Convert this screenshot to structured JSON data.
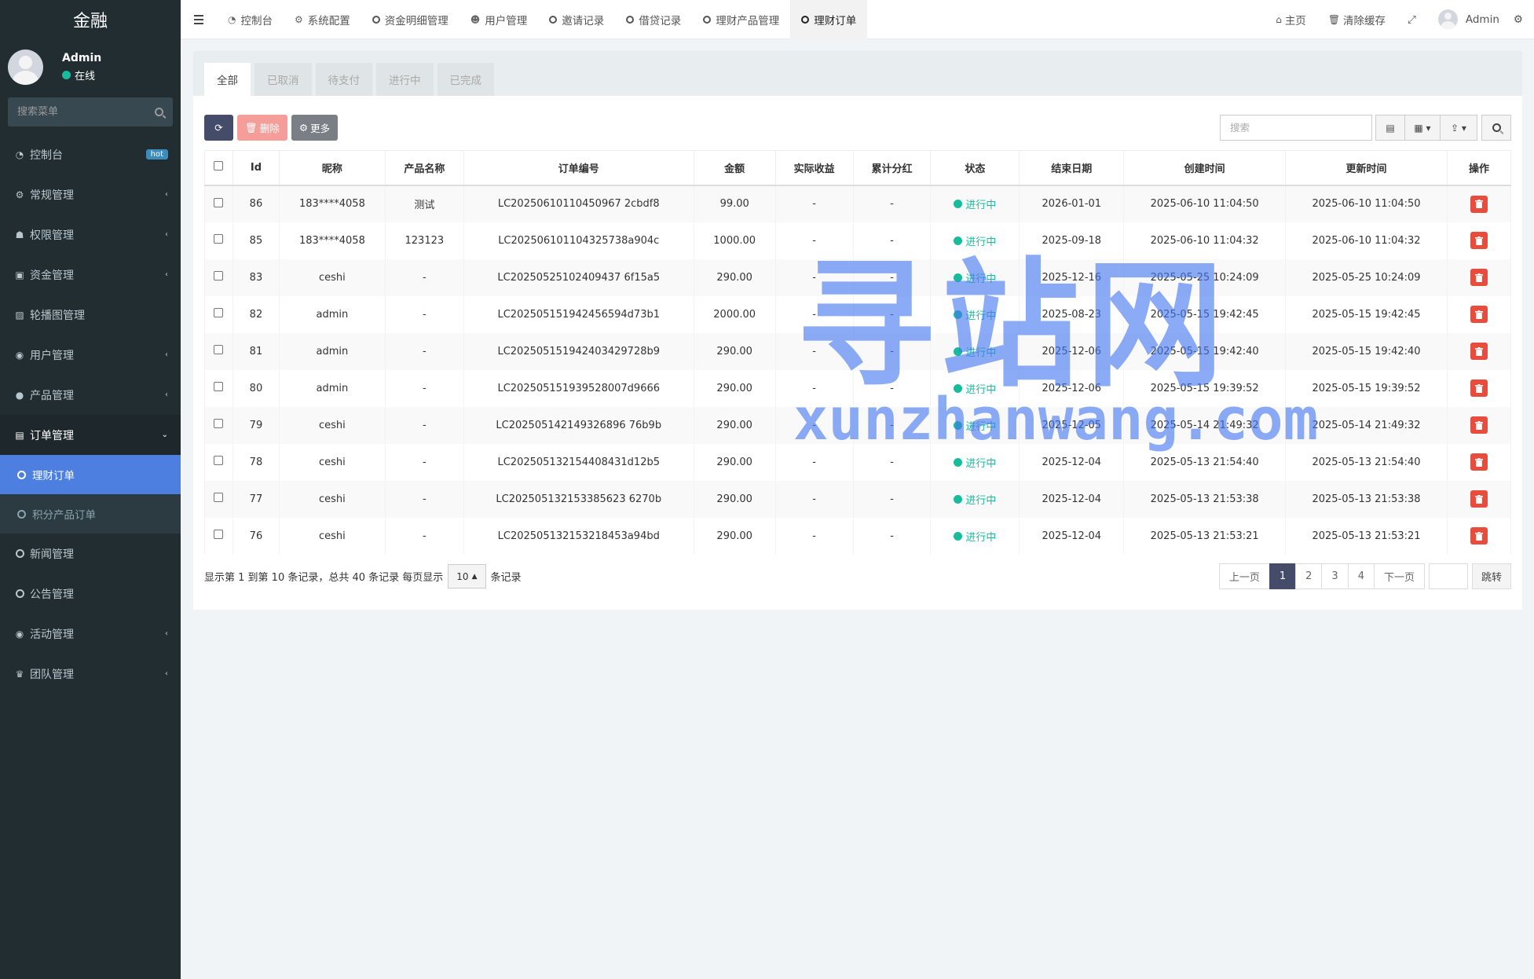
{
  "sidebar": {
    "logo": "金融",
    "user": {
      "name": "Admin",
      "status": "在线"
    },
    "search_placeholder": "搜索菜单",
    "menu": [
      {
        "label": "控制台",
        "icon": "dashboard-icon",
        "badge": "hot"
      },
      {
        "label": "常规管理",
        "icon": "cogs-icon",
        "chevron": "‹"
      },
      {
        "label": "权限管理",
        "icon": "group-icon",
        "chevron": "‹"
      },
      {
        "label": "资金管理",
        "icon": "money-icon",
        "chevron": "‹"
      },
      {
        "label": "轮播图管理",
        "icon": "image-icon"
      },
      {
        "label": "用户管理",
        "icon": "user-circle-icon",
        "chevron": "‹"
      },
      {
        "label": "产品管理",
        "icon": "product-icon",
        "chevron": "‹"
      },
      {
        "label": "订单管理",
        "icon": "order-icon",
        "chevron": "⌄"
      }
    ],
    "submenu": [
      {
        "label": "理财订单",
        "active": true
      },
      {
        "label": "积分产品订单"
      }
    ],
    "menu_after": [
      {
        "label": "新闻管理",
        "icon": "circle-icon"
      },
      {
        "label": "公告管理",
        "icon": "circle-icon"
      },
      {
        "label": "活动管理",
        "icon": "play-circle-icon",
        "chevron": "‹"
      },
      {
        "label": "团队管理",
        "icon": "trophy-icon",
        "chevron": "‹"
      }
    ]
  },
  "header": {
    "tabs": [
      {
        "label": "控制台",
        "icon": "dashboard-icon"
      },
      {
        "label": "系统配置",
        "icon": "cog-icon"
      },
      {
        "label": "资金明细管理",
        "icon": "circle-icon"
      },
      {
        "label": "用户管理",
        "icon": "user-icon"
      },
      {
        "label": "邀请记录",
        "icon": "circle-icon"
      },
      {
        "label": "借贷记录",
        "icon": "circle-icon"
      },
      {
        "label": "理财产品管理",
        "icon": "circle-icon"
      },
      {
        "label": "理财订单",
        "icon": "circle-icon",
        "active": true
      }
    ],
    "home": "主页",
    "clear_cache": "清除缓存",
    "user": "Admin"
  },
  "panel": {
    "tabs": [
      "全部",
      "已取消",
      "待支付",
      "进行中",
      "已完成"
    ],
    "toolbar": {
      "delete": "删除",
      "more": "更多",
      "search_placeholder": "搜索"
    },
    "columns": [
      "Id",
      "昵称",
      "产品名称",
      "订单编号",
      "金额",
      "实际收益",
      "累计分红",
      "状态",
      "结束日期",
      "创建时间",
      "更新时间",
      "操作"
    ],
    "rows": [
      [
        "86",
        "183****4058",
        "测试",
        "LC20250610110450967 2cbdf8",
        "99.00",
        "-",
        "-",
        "进行中",
        "2026-01-01",
        "2025-06-10 11:04:50",
        "2025-06-10 11:04:50"
      ],
      [
        "85",
        "183****4058",
        "123123",
        "LC202506101104325738a904c",
        "1000.00",
        "-",
        "-",
        "进行中",
        "2025-09-18",
        "2025-06-10 11:04:32",
        "2025-06-10 11:04:32"
      ],
      [
        "83",
        "ceshi",
        "-",
        "LC20250525102409437 6f15a5",
        "290.00",
        "-",
        "-",
        "进行中",
        "2025-12-16",
        "2025-05-25 10:24:09",
        "2025-05-25 10:24:09"
      ],
      [
        "82",
        "admin",
        "-",
        "LC202505151942456594d73b1",
        "2000.00",
        "-",
        "-",
        "进行中",
        "2025-08-23",
        "2025-05-15 19:42:45",
        "2025-05-15 19:42:45"
      ],
      [
        "81",
        "admin",
        "-",
        "LC202505151942403429728b9",
        "290.00",
        "-",
        "-",
        "进行中",
        "2025-12-06",
        "2025-05-15 19:42:40",
        "2025-05-15 19:42:40"
      ],
      [
        "80",
        "admin",
        "-",
        "LC202505151939528007d9666",
        "290.00",
        "-",
        "-",
        "进行中",
        "2025-12-06",
        "2025-05-15 19:39:52",
        "2025-05-15 19:39:52"
      ],
      [
        "79",
        "ceshi",
        "-",
        "LC202505142149326896 76b9b",
        "290.00",
        "-",
        "-",
        "进行中",
        "2025-12-05",
        "2025-05-14 21:49:32",
        "2025-05-14 21:49:32"
      ],
      [
        "78",
        "ceshi",
        "-",
        "LC202505132154408431d12b5",
        "290.00",
        "-",
        "-",
        "进行中",
        "2025-12-04",
        "2025-05-13 21:54:40",
        "2025-05-13 21:54:40"
      ],
      [
        "77",
        "ceshi",
        "-",
        "LC202505132153385623 6270b",
        "290.00",
        "-",
        "-",
        "进行中",
        "2025-12-04",
        "2025-05-13 21:53:38",
        "2025-05-13 21:53:38"
      ],
      [
        "76",
        "ceshi",
        "-",
        "LC202505132153218453a94bd",
        "290.00",
        "-",
        "-",
        "进行中",
        "2025-12-04",
        "2025-05-13 21:53:21",
        "2025-05-13 21:53:21"
      ]
    ],
    "footer": {
      "summary": "显示第 1 到第 10 条记录，总共 40 条记录 每页显示",
      "page_size": "10",
      "suffix": "条记录",
      "prev": "上一页",
      "pages": [
        "1",
        "2",
        "3",
        "4"
      ],
      "next": "下一页",
      "go": "跳转"
    }
  },
  "watermark": {
    "cn": "寻站网",
    "en": "xunzhanwang.com"
  },
  "colors": {
    "sidebar": "#222d32",
    "active_sub": "#4c7fe0",
    "primary": "#444c69",
    "success": "#18bc9c",
    "danger": "#e74c3c"
  }
}
